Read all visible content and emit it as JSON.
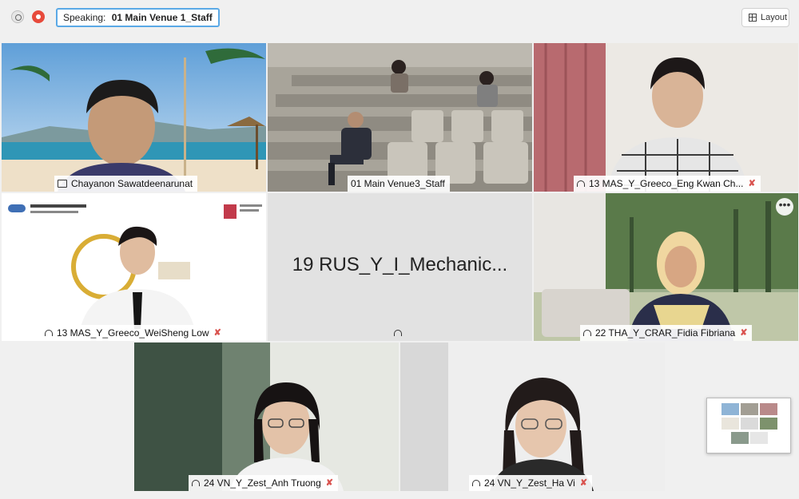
{
  "window": {
    "speaking_label": "Speaking:",
    "speaking_name": "01 Main Venue 1_Staff",
    "layout_label": "Layout"
  },
  "participants": [
    {
      "name": "Chayanon Sawatdeenarunat",
      "icon": "screen-icon",
      "muted": false
    },
    {
      "name": "01 Main Venue3_Staff",
      "icon": "none",
      "muted": false
    },
    {
      "name": "13 MAS_Y_Greeco_Eng Kwan Ch...",
      "icon": "headset-icon",
      "muted": true
    },
    {
      "name": "13 MAS_Y_Greeco_WeiSheng Low",
      "icon": "headset-icon",
      "muted": true
    },
    {
      "name": "19 RUS_Y_I_Mechanic...",
      "icon": "headset-icon",
      "muted": false
    },
    {
      "name": "22 THA_Y_CRAR_Fidia Fibriana",
      "icon": "headset-icon",
      "muted": true
    },
    {
      "name": "24 VN_Y_Zest_Anh Truong",
      "icon": "headset-icon",
      "muted": true
    },
    {
      "name": "24 VN_Y_Zest_Ha Vi",
      "icon": "headset-icon",
      "muted": true
    }
  ],
  "mute_glyph": "✘",
  "more_glyph": "•••",
  "colors": {
    "accent": "#5aa9e6",
    "record": "#e74a3b",
    "muted": "#d9534f"
  }
}
